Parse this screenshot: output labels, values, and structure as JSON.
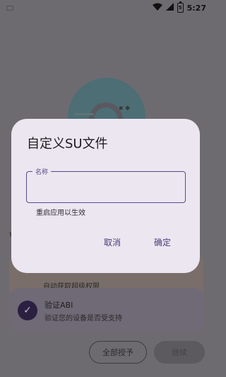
{
  "status_bar": {
    "time": "5:27",
    "battery_level": "5"
  },
  "background": {
    "partial_left_text": "¥",
    "card_one_subtitle": "自动获取超级权限",
    "card_two": {
      "title": "验证ABI",
      "subtitle": "验证您的设备是否受支持"
    },
    "grant_all_label": "全部授予",
    "continue_label": "继续"
  },
  "dialog": {
    "title": "自定义SU文件",
    "field_label": "名称",
    "field_value": "",
    "helper_text": "重启应用以生效",
    "cancel_label": "取消",
    "ok_label": "确定"
  },
  "colors": {
    "scrim": "#6e6b70",
    "dialog_bg": "#ece6f1",
    "accent": "#5a4a86"
  }
}
